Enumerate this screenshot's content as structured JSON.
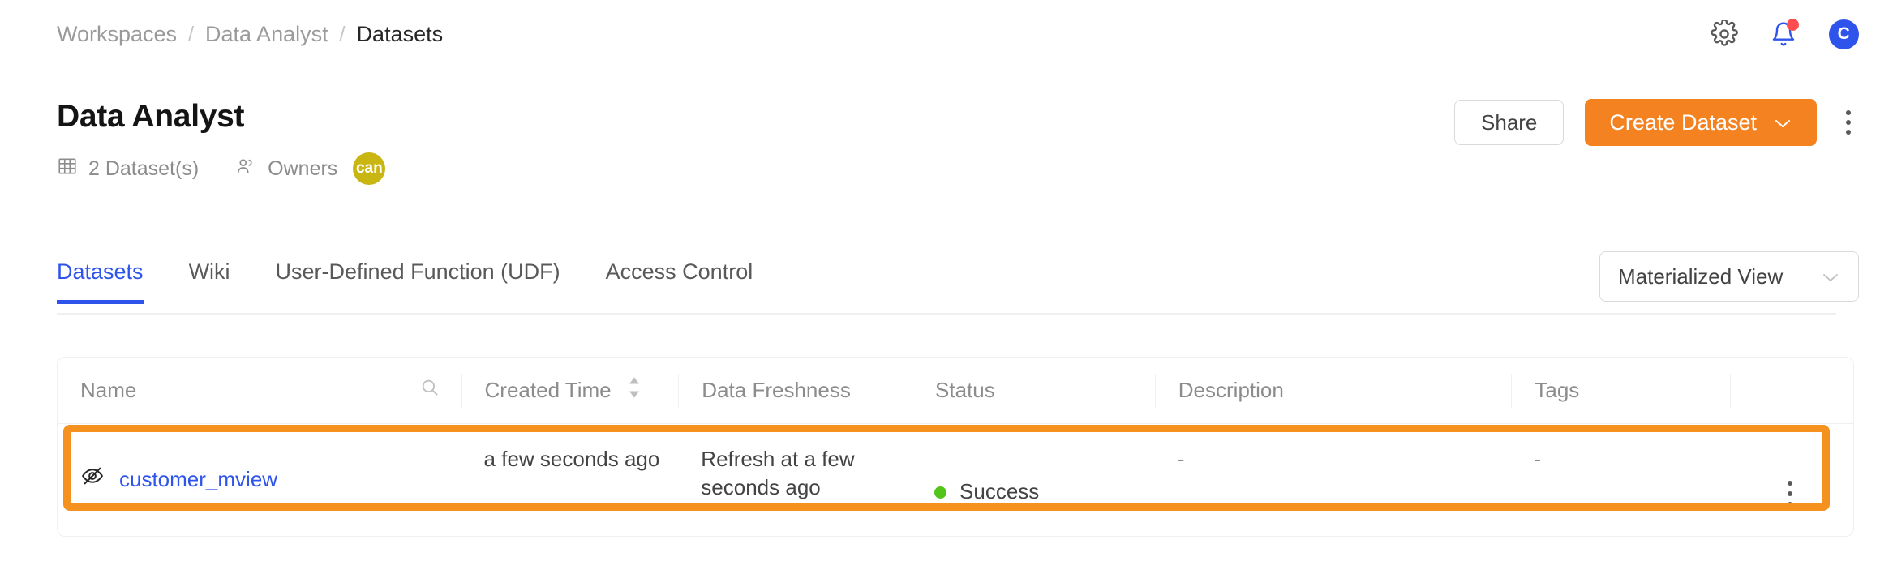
{
  "breadcrumb": {
    "items": [
      {
        "label": "Workspaces",
        "current": false
      },
      {
        "label": "Data Analyst",
        "current": false
      },
      {
        "label": "Datasets",
        "current": true
      }
    ],
    "separator": "/"
  },
  "topbar": {
    "settings_icon": "gear-icon",
    "notifications_icon": "bell-icon",
    "has_notification_badge": true,
    "avatar_initial": "C",
    "avatar_color": "#2f54eb"
  },
  "header": {
    "title": "Data Analyst",
    "dataset_count_label": "2 Dataset(s)",
    "dataset_count_icon": "table-grid-icon",
    "owners_label": "Owners",
    "owners_icon": "people-icon",
    "owner_avatar_label": "can",
    "owner_avatar_color": "#c9b613",
    "share_label": "Share",
    "create_label": "Create Dataset",
    "create_color": "#f58220",
    "more_icon": "kebab-menu-icon"
  },
  "tabs": {
    "items": [
      {
        "label": "Datasets",
        "active": true
      },
      {
        "label": "Wiki",
        "active": false
      },
      {
        "label": "User-Defined Function (UDF)",
        "active": false
      },
      {
        "label": "Access Control",
        "active": false
      }
    ],
    "active_color": "#2f54eb"
  },
  "view_select": {
    "value": "Materialized View",
    "chevron_icon": "chevron-down-icon"
  },
  "table": {
    "columns": [
      {
        "label": "Name",
        "icon": "search-icon"
      },
      {
        "label": "Created Time",
        "icon": "sort-icon"
      },
      {
        "label": "Data Freshness",
        "icon": ""
      },
      {
        "label": "Status",
        "icon": ""
      },
      {
        "label": "Description",
        "icon": ""
      },
      {
        "label": "Tags",
        "icon": ""
      },
      {
        "label": "",
        "icon": ""
      }
    ],
    "rows": [
      {
        "visibility_icon": "eye-slash-icon",
        "name": "customer_mview",
        "created_time": "a few seconds ago",
        "data_freshness": "Refresh at a few seconds ago",
        "status": "Success",
        "status_color": "#52c41a",
        "description": "-",
        "tags": "-",
        "actions_icon": "kebab-menu-icon",
        "highlighted": true
      }
    ],
    "highlight_color": "#f5911e"
  }
}
